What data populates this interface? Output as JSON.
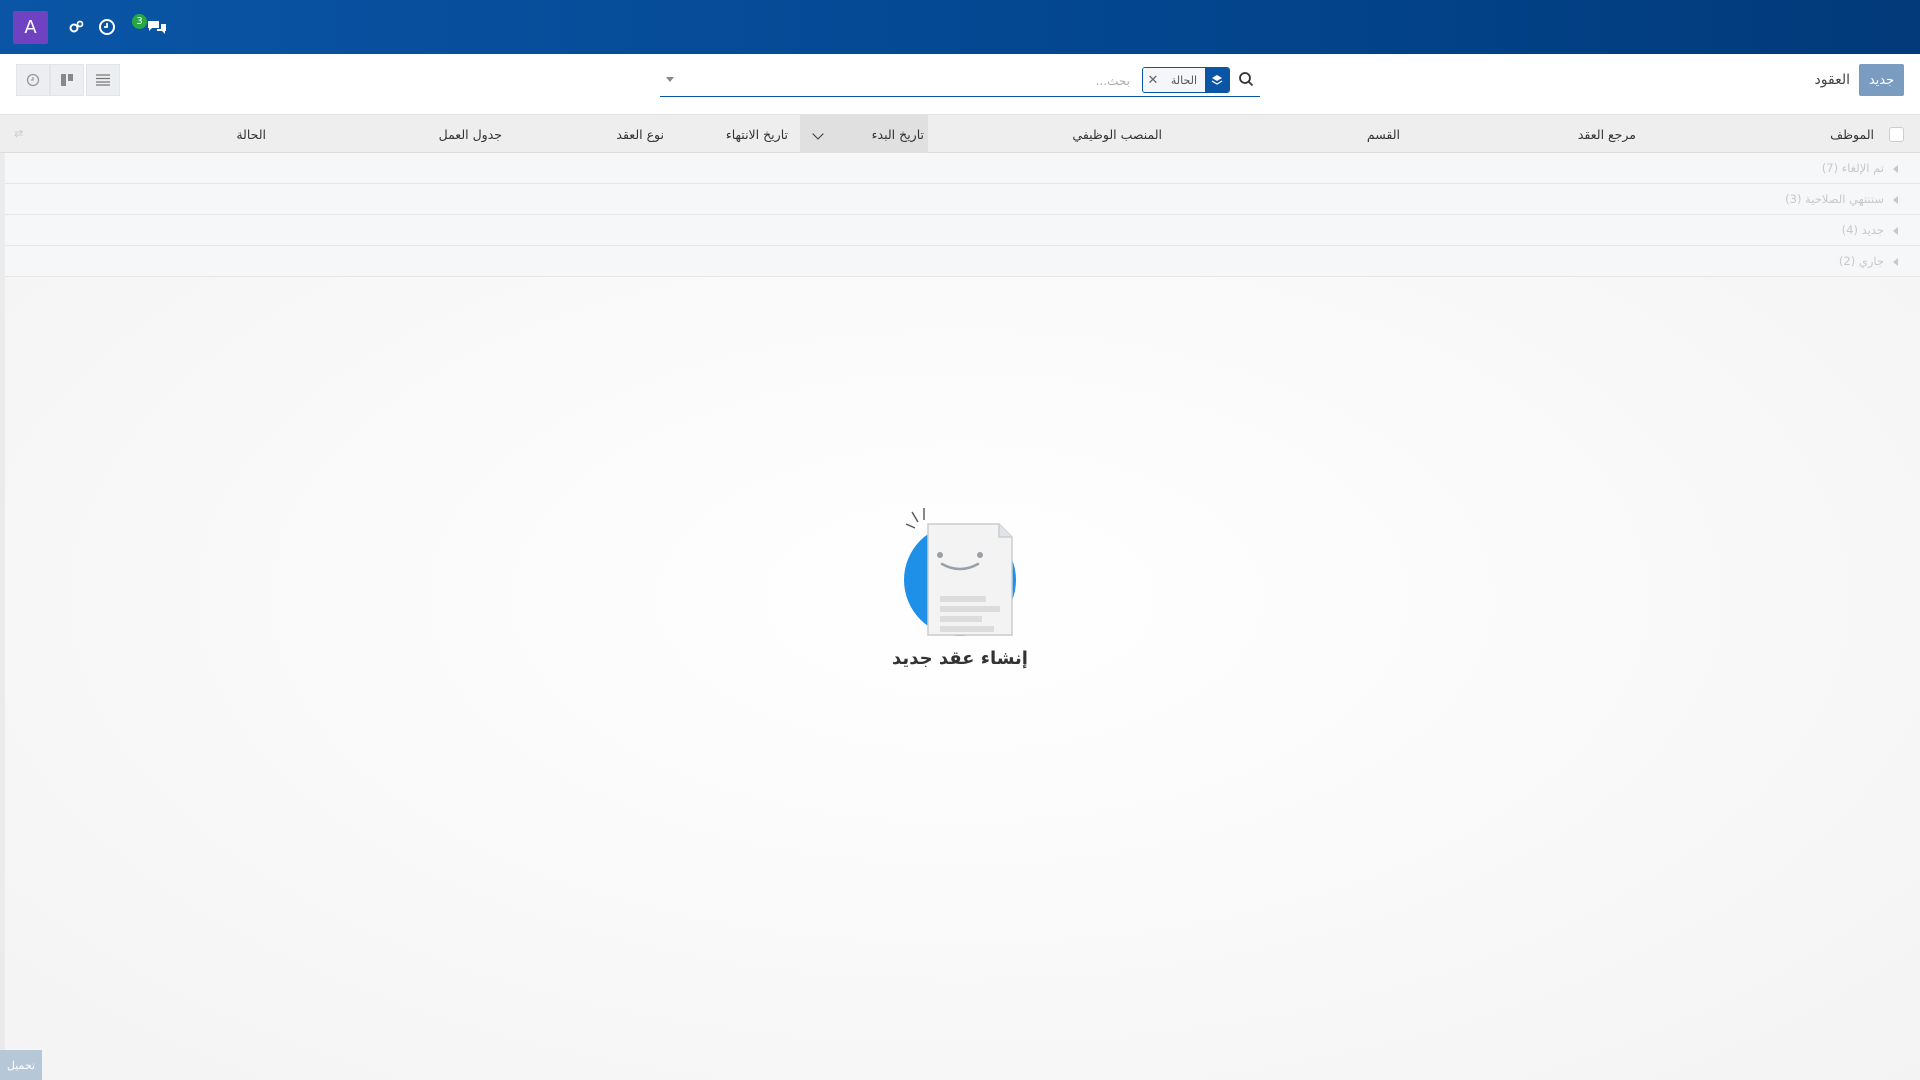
{
  "navbar": {
    "avatar_letter": "A",
    "chat_count": "3",
    "icons": [
      "settings-gear-icon",
      "activity-clock-icon",
      "chat-icon"
    ],
    "color": "#0a55a6"
  },
  "control": {
    "new_button": "جديد",
    "title": "العقود",
    "search": {
      "facet_label": "الحالة",
      "placeholder": "بحث..."
    }
  },
  "table": {
    "columns": [
      "الموظف",
      "مرجع العقد",
      "القسم",
      "المنصب الوظيفي",
      "تاريخ البدء",
      "تاريخ الانتهاء",
      "نوع العقد",
      "جدول العمل",
      "الحالة"
    ]
  },
  "groups": [
    {
      "label": "تم الإلغاء (7)"
    },
    {
      "label": "ستنتهي الصلاحية (3)"
    },
    {
      "label": "جديد (4)"
    },
    {
      "label": "جاري (2)"
    }
  ],
  "empty_state": {
    "title": "إنشاء عقد جديد"
  },
  "footer": {
    "load_button": "تحميل"
  },
  "colors": {
    "accent": "#0a55a6",
    "avatar": "#6f42c1",
    "badge": "#28a745",
    "new_button": "#7a9cc0",
    "helper_circle": "#1e90e8"
  }
}
